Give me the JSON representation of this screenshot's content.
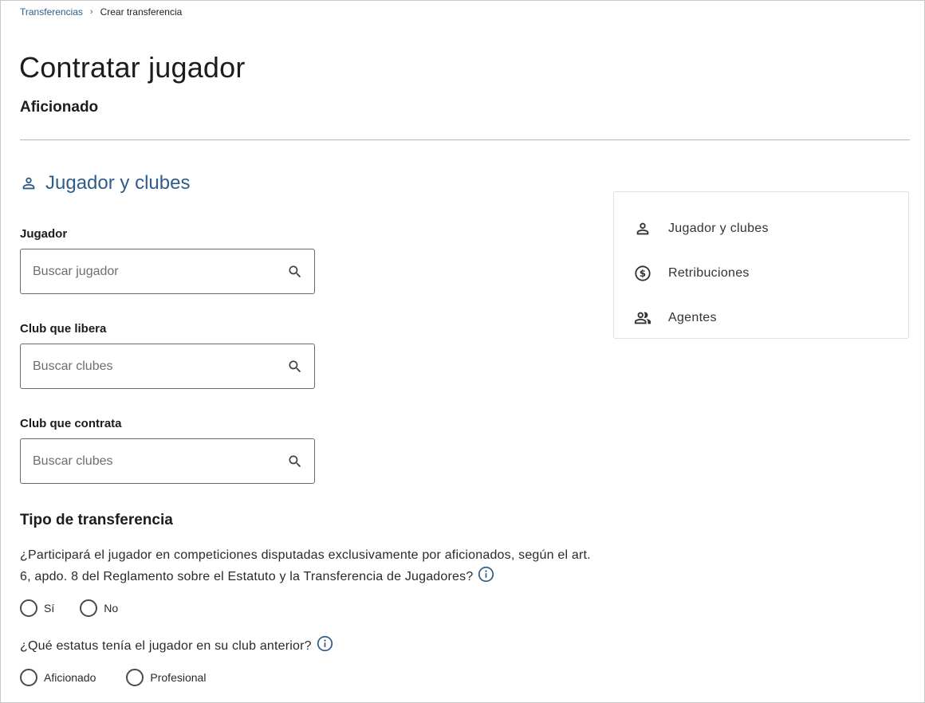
{
  "breadcrumb": {
    "link": "Transferencias",
    "separator": "›",
    "current": "Crear transferencia"
  },
  "page_title": "Contratar jugador",
  "subtitle": "Aficionado",
  "section": {
    "title": "Jugador y clubes",
    "icon": "person-icon"
  },
  "fields": {
    "player": {
      "label": "Jugador",
      "placeholder": "Buscar jugador",
      "value": ""
    },
    "releasing_club": {
      "label": "Club que libera",
      "placeholder": "Buscar clubes",
      "value": ""
    },
    "hiring_club": {
      "label": "Club que contrata",
      "placeholder": "Buscar clubes",
      "value": ""
    }
  },
  "transfer_type": {
    "heading": "Tipo de transferencia",
    "q1": {
      "text": "¿Participará el jugador en competiciones disputadas exclusivamente por aficionados, según el art. 6, apdo. 8 del Reglamento sobre el Estatuto y la Transferencia de Jugadores?",
      "options": [
        "Sí",
        "No"
      ]
    },
    "q2": {
      "text": "¿Qué estatus tenía el jugador en su club anterior?",
      "options": [
        "Aficionado",
        "Profesional"
      ]
    }
  },
  "toc": [
    {
      "label": "Jugador y clubes",
      "icon": "person-icon"
    },
    {
      "label": "Retribuciones",
      "icon": "dollar-circle-icon"
    },
    {
      "label": "Agentes",
      "icon": "people-icon"
    }
  ],
  "colors": {
    "accent": "#2f5d8a",
    "text": "#1c1c1c",
    "border": "#6b6b6b",
    "divider": "#aab7c4"
  }
}
